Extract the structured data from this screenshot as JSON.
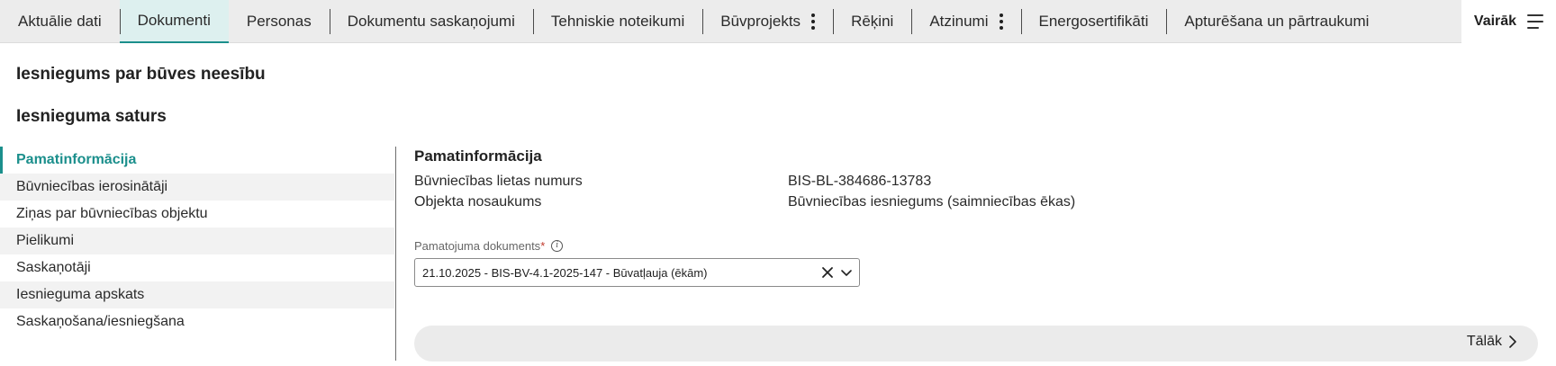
{
  "tabs": [
    {
      "label": "Aktuālie dati"
    },
    {
      "label": "Dokumenti"
    },
    {
      "label": "Personas"
    },
    {
      "label": "Dokumentu saskaņojumi"
    },
    {
      "label": "Tehniskie noteikumi"
    },
    {
      "label": "Būvprojekts"
    },
    {
      "label": "Rēķini"
    },
    {
      "label": "Atzinumi"
    },
    {
      "label": "Energosertifikāti"
    },
    {
      "label": "Apturēšana un pārtraukumi"
    }
  ],
  "active_tab": "Dokumenti",
  "more": {
    "label": "Vairāk"
  },
  "page_title": "Iesniegums par būves neesību",
  "section_title": "Iesnieguma saturs",
  "nav": {
    "items": [
      {
        "label": "Pamatinformācija"
      },
      {
        "label": "Būvniecības ierosinātāji"
      },
      {
        "label": "Ziņas par būvniecības objektu"
      },
      {
        "label": "Pielikumi"
      },
      {
        "label": "Saskaņotāji"
      },
      {
        "label": "Iesnieguma apskats"
      },
      {
        "label": "Saskaņošana/iesniegšana"
      }
    ],
    "active": "Pamatinformācija"
  },
  "content": {
    "title": "Pamatinformācija",
    "rows": [
      {
        "label": "Būvniecības lietas numurs",
        "value": "BIS-BL-384686-13783"
      },
      {
        "label": "Objekta nosaukums",
        "value": "Būvniecības iesniegums (saimniecības ēkas)"
      }
    ],
    "field": {
      "label": "Pamatojuma dokuments",
      "required_mark": "*",
      "info_glyph": "i",
      "value": "21.10.2025 - BIS-BV-4.1-2025-147 - Būvatļauja (ēkām)"
    },
    "next_label": "Tālāk"
  },
  "colors": {
    "accent": "#1b8f8c",
    "active_tab_bg": "#ddf0ef",
    "tabbar_bg": "#ececec",
    "required": "#c0392b"
  }
}
